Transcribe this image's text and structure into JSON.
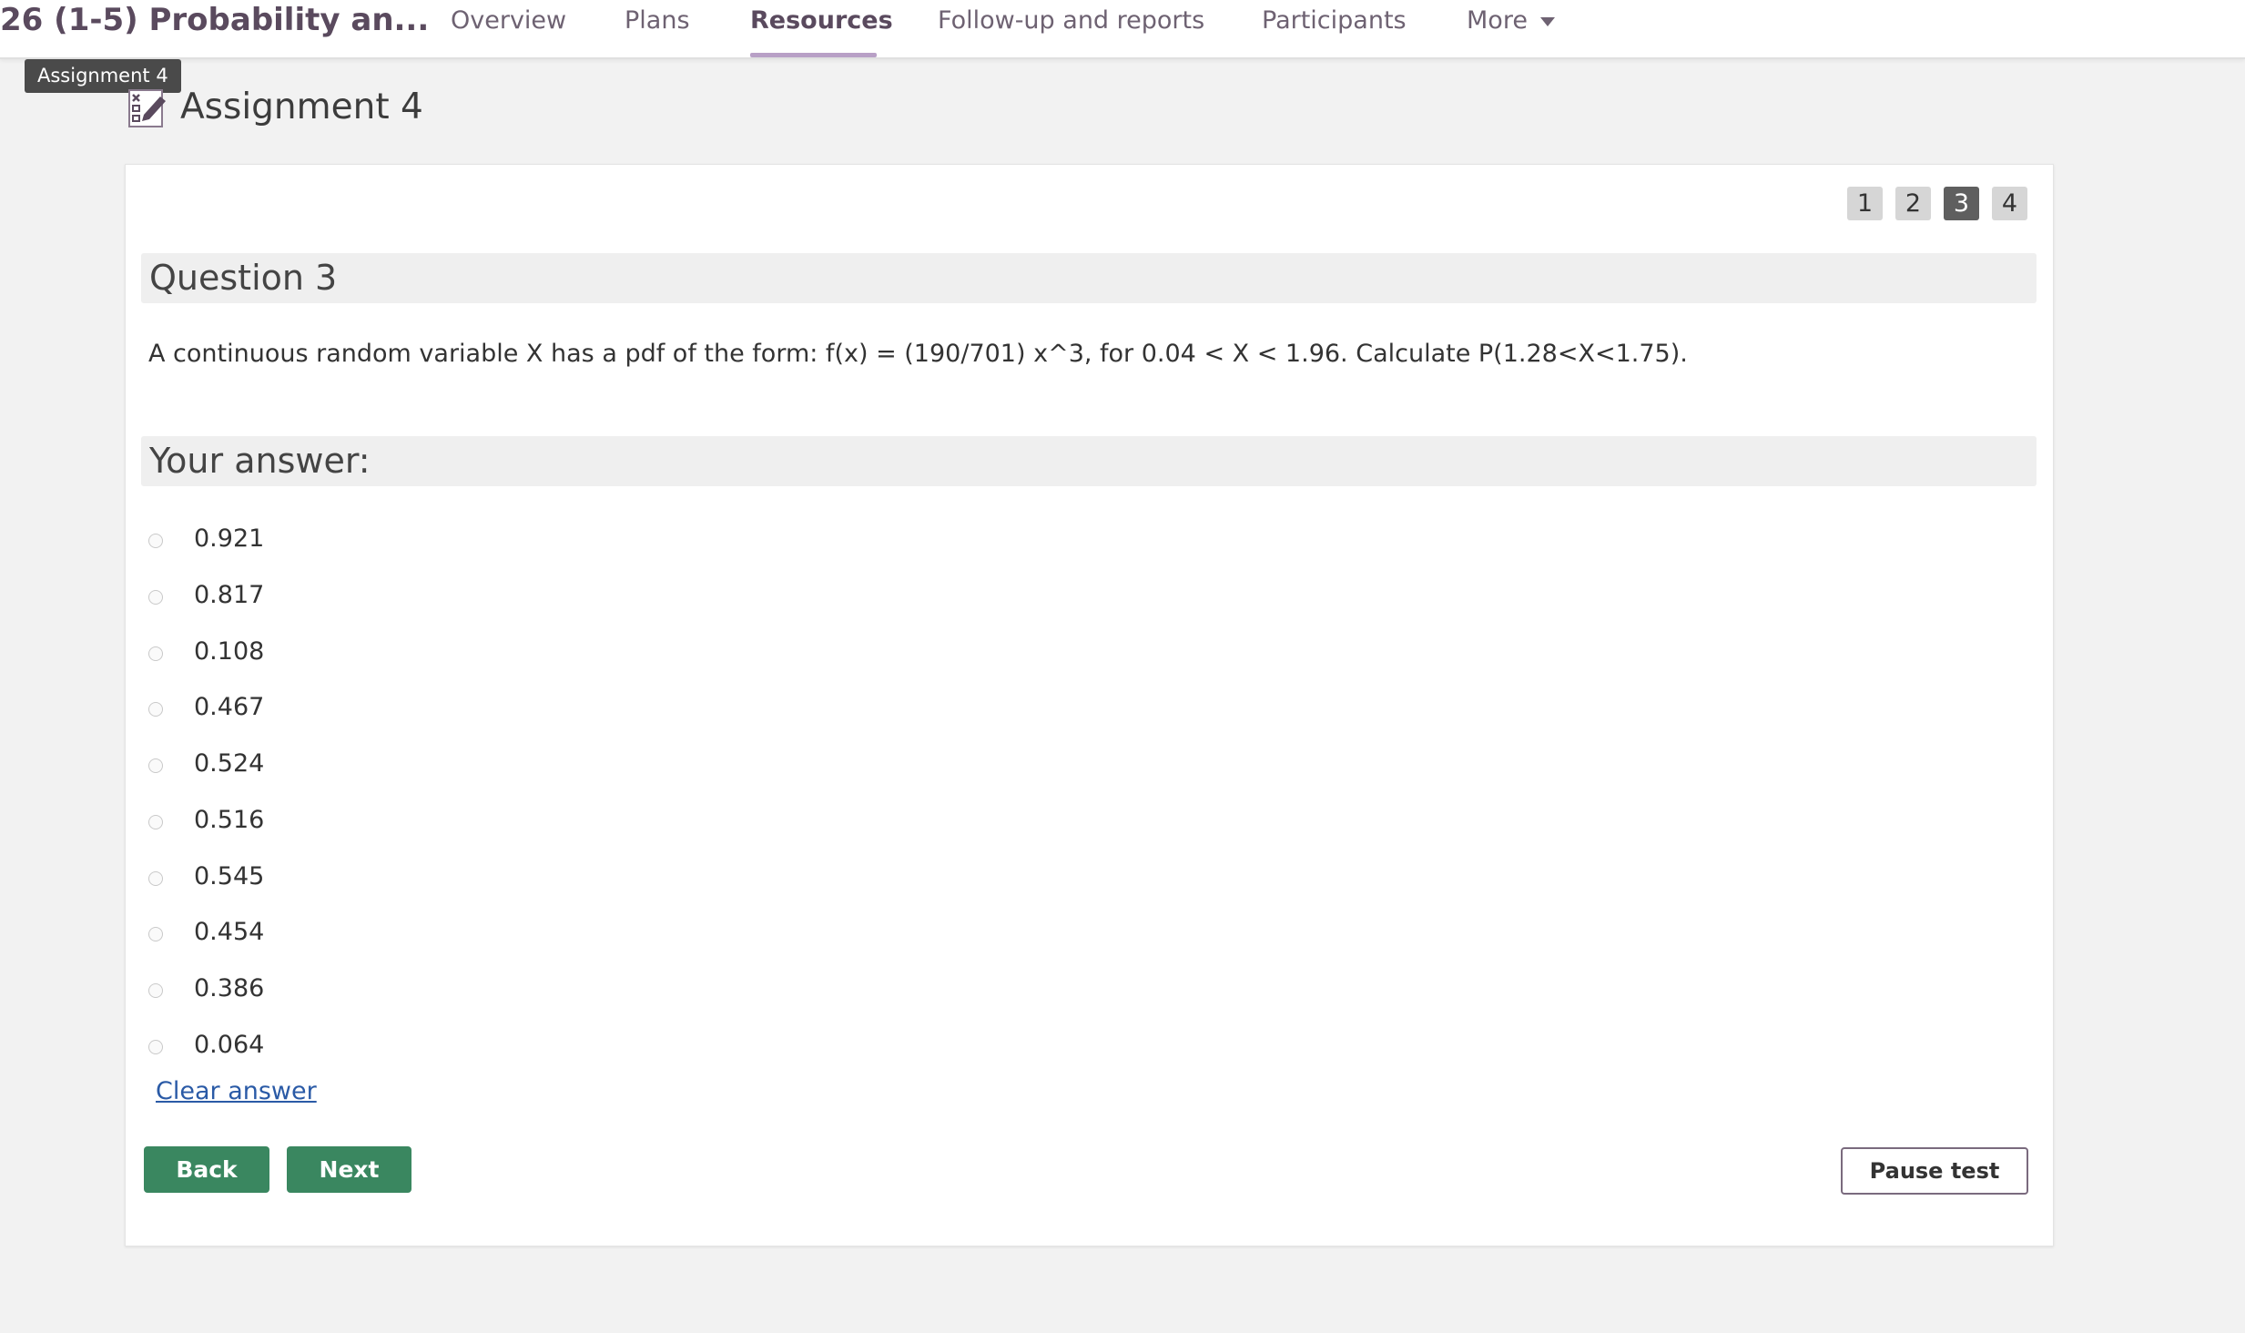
{
  "header": {
    "course_title": "26 (1-5) Probability an...",
    "nav": [
      {
        "label": "Overview"
      },
      {
        "label": "Plans"
      },
      {
        "label": "Resources"
      },
      {
        "label": "Follow-up and reports"
      },
      {
        "label": "Participants"
      },
      {
        "label": "More"
      }
    ],
    "active_nav": "Resources",
    "tooltip": "Assignment 4"
  },
  "page": {
    "title": "Assignment 4",
    "icon": "assignment-icon"
  },
  "pager": {
    "pages": [
      "1",
      "2",
      "3",
      "4"
    ],
    "current": "3"
  },
  "question": {
    "heading": "Question 3",
    "text": "A continuous random variable X has a pdf of the form: f(x) = (190/701) x^3, for 0.04 < X < 1.96. Calculate P(1.28<X<1.75)."
  },
  "answer": {
    "heading": "Your answer:",
    "options": [
      "0.921",
      "0.817",
      "0.108",
      "0.467",
      "0.524",
      "0.516",
      "0.545",
      "0.454",
      "0.386",
      "0.064"
    ],
    "clear_label": "Clear answer"
  },
  "buttons": {
    "back": "Back",
    "next": "Next",
    "pause": "Pause test"
  },
  "colors": {
    "primary_green": "#3a8760",
    "brand_purple": "#5a4a5e",
    "active_underline": "#b8a0c6",
    "link_blue": "#2a5aa6"
  }
}
